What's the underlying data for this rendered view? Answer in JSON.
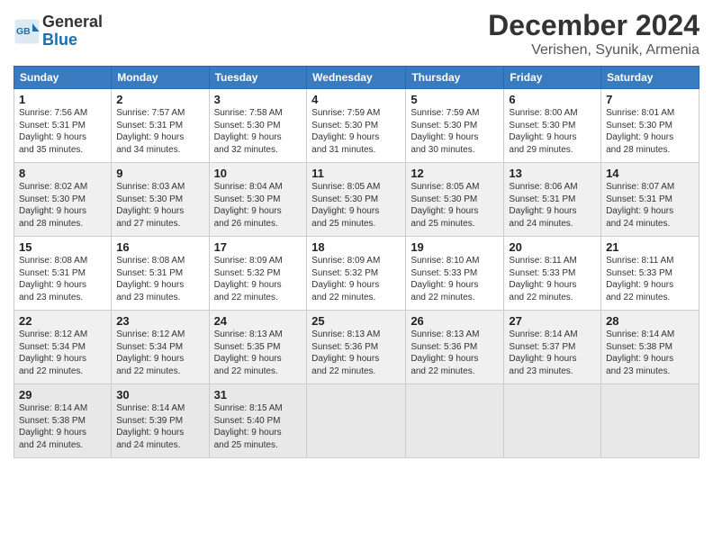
{
  "header": {
    "logo_line1": "General",
    "logo_line2": "Blue",
    "month": "December 2024",
    "location": "Verishen, Syunik, Armenia"
  },
  "weekdays": [
    "Sunday",
    "Monday",
    "Tuesday",
    "Wednesday",
    "Thursday",
    "Friday",
    "Saturday"
  ],
  "weeks": [
    [
      {
        "day": "1",
        "info": "Sunrise: 7:56 AM\nSunset: 5:31 PM\nDaylight: 9 hours\nand 35 minutes."
      },
      {
        "day": "2",
        "info": "Sunrise: 7:57 AM\nSunset: 5:31 PM\nDaylight: 9 hours\nand 34 minutes."
      },
      {
        "day": "3",
        "info": "Sunrise: 7:58 AM\nSunset: 5:30 PM\nDaylight: 9 hours\nand 32 minutes."
      },
      {
        "day": "4",
        "info": "Sunrise: 7:59 AM\nSunset: 5:30 PM\nDaylight: 9 hours\nand 31 minutes."
      },
      {
        "day": "5",
        "info": "Sunrise: 7:59 AM\nSunset: 5:30 PM\nDaylight: 9 hours\nand 30 minutes."
      },
      {
        "day": "6",
        "info": "Sunrise: 8:00 AM\nSunset: 5:30 PM\nDaylight: 9 hours\nand 29 minutes."
      },
      {
        "day": "7",
        "info": "Sunrise: 8:01 AM\nSunset: 5:30 PM\nDaylight: 9 hours\nand 28 minutes."
      }
    ],
    [
      {
        "day": "8",
        "info": "Sunrise: 8:02 AM\nSunset: 5:30 PM\nDaylight: 9 hours\nand 28 minutes."
      },
      {
        "day": "9",
        "info": "Sunrise: 8:03 AM\nSunset: 5:30 PM\nDaylight: 9 hours\nand 27 minutes."
      },
      {
        "day": "10",
        "info": "Sunrise: 8:04 AM\nSunset: 5:30 PM\nDaylight: 9 hours\nand 26 minutes."
      },
      {
        "day": "11",
        "info": "Sunrise: 8:05 AM\nSunset: 5:30 PM\nDaylight: 9 hours\nand 25 minutes."
      },
      {
        "day": "12",
        "info": "Sunrise: 8:05 AM\nSunset: 5:30 PM\nDaylight: 9 hours\nand 25 minutes."
      },
      {
        "day": "13",
        "info": "Sunrise: 8:06 AM\nSunset: 5:31 PM\nDaylight: 9 hours\nand 24 minutes."
      },
      {
        "day": "14",
        "info": "Sunrise: 8:07 AM\nSunset: 5:31 PM\nDaylight: 9 hours\nand 24 minutes."
      }
    ],
    [
      {
        "day": "15",
        "info": "Sunrise: 8:08 AM\nSunset: 5:31 PM\nDaylight: 9 hours\nand 23 minutes."
      },
      {
        "day": "16",
        "info": "Sunrise: 8:08 AM\nSunset: 5:31 PM\nDaylight: 9 hours\nand 23 minutes."
      },
      {
        "day": "17",
        "info": "Sunrise: 8:09 AM\nSunset: 5:32 PM\nDaylight: 9 hours\nand 22 minutes."
      },
      {
        "day": "18",
        "info": "Sunrise: 8:09 AM\nSunset: 5:32 PM\nDaylight: 9 hours\nand 22 minutes."
      },
      {
        "day": "19",
        "info": "Sunrise: 8:10 AM\nSunset: 5:33 PM\nDaylight: 9 hours\nand 22 minutes."
      },
      {
        "day": "20",
        "info": "Sunrise: 8:11 AM\nSunset: 5:33 PM\nDaylight: 9 hours\nand 22 minutes."
      },
      {
        "day": "21",
        "info": "Sunrise: 8:11 AM\nSunset: 5:33 PM\nDaylight: 9 hours\nand 22 minutes."
      }
    ],
    [
      {
        "day": "22",
        "info": "Sunrise: 8:12 AM\nSunset: 5:34 PM\nDaylight: 9 hours\nand 22 minutes."
      },
      {
        "day": "23",
        "info": "Sunrise: 8:12 AM\nSunset: 5:34 PM\nDaylight: 9 hours\nand 22 minutes."
      },
      {
        "day": "24",
        "info": "Sunrise: 8:13 AM\nSunset: 5:35 PM\nDaylight: 9 hours\nand 22 minutes."
      },
      {
        "day": "25",
        "info": "Sunrise: 8:13 AM\nSunset: 5:36 PM\nDaylight: 9 hours\nand 22 minutes."
      },
      {
        "day": "26",
        "info": "Sunrise: 8:13 AM\nSunset: 5:36 PM\nDaylight: 9 hours\nand 22 minutes."
      },
      {
        "day": "27",
        "info": "Sunrise: 8:14 AM\nSunset: 5:37 PM\nDaylight: 9 hours\nand 23 minutes."
      },
      {
        "day": "28",
        "info": "Sunrise: 8:14 AM\nSunset: 5:38 PM\nDaylight: 9 hours\nand 23 minutes."
      }
    ],
    [
      {
        "day": "29",
        "info": "Sunrise: 8:14 AM\nSunset: 5:38 PM\nDaylight: 9 hours\nand 24 minutes."
      },
      {
        "day": "30",
        "info": "Sunrise: 8:14 AM\nSunset: 5:39 PM\nDaylight: 9 hours\nand 24 minutes."
      },
      {
        "day": "31",
        "info": "Sunrise: 8:15 AM\nSunset: 5:40 PM\nDaylight: 9 hours\nand 25 minutes."
      },
      {
        "day": "",
        "info": ""
      },
      {
        "day": "",
        "info": ""
      },
      {
        "day": "",
        "info": ""
      },
      {
        "day": "",
        "info": ""
      }
    ]
  ]
}
